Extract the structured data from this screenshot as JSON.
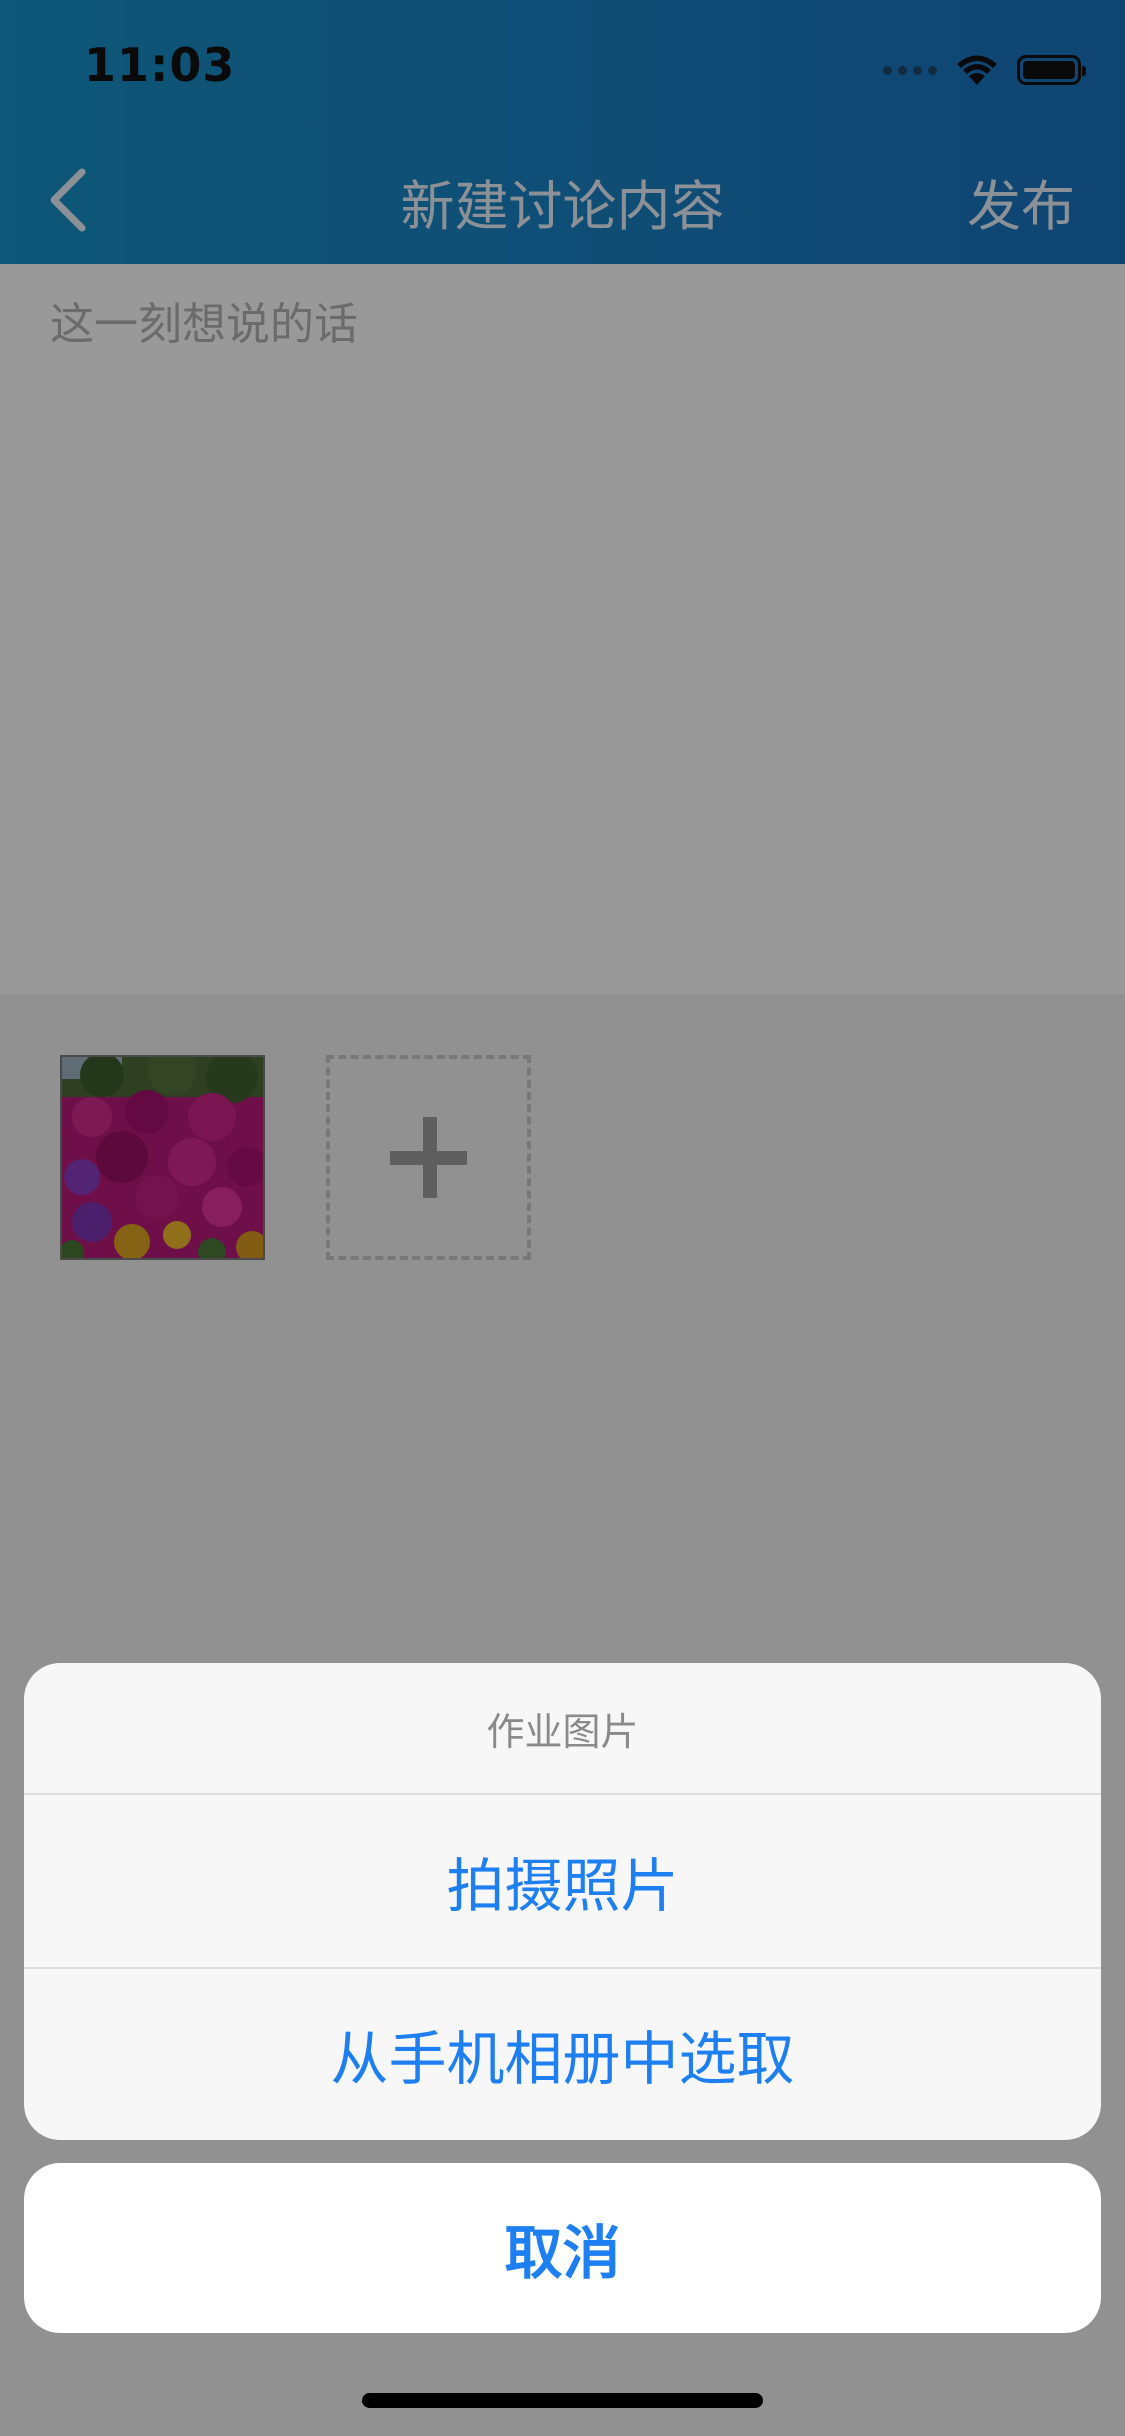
{
  "status_bar": {
    "time": "11:03"
  },
  "header": {
    "title": "新建讨论内容",
    "publish_label": "发布"
  },
  "editor": {
    "placeholder": "这一刻想说的话"
  },
  "action_sheet": {
    "title": "作业图片",
    "options": [
      "拍摄照片",
      "从手机相册中选取"
    ],
    "cancel_label": "取消"
  },
  "colors": {
    "header_blue": "#1a7fc4",
    "action_blue": "#1e7ff0"
  }
}
